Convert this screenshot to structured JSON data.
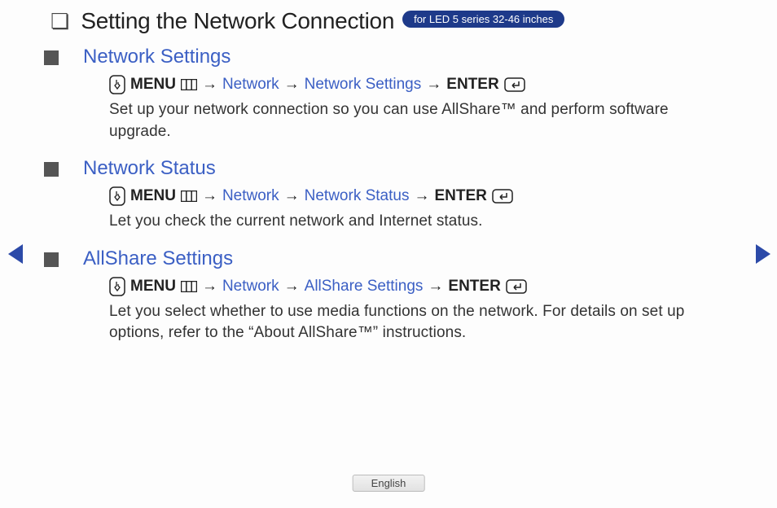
{
  "title": "Setting the Network Connection",
  "badge": "for LED 5 series 32-46 inches",
  "language": "English",
  "menu_label": "MENU",
  "enter_label": "ENTER",
  "arrow": "→",
  "sections": [
    {
      "heading": "Network Settings",
      "path_item1": "Network",
      "path_item2": "Network Settings",
      "description": "Set up your network connection so you can use AllShare™ and perform software upgrade."
    },
    {
      "heading": "Network Status",
      "path_item1": "Network",
      "path_item2": "Network Status",
      "description": "Let you check the current network and Internet status."
    },
    {
      "heading": "AllShare Settings",
      "path_item1": "Network",
      "path_item2": "AllShare Settings",
      "description": "Let you select whether to use media functions on the network. For details on set up options, refer to the “About AllShare™” instructions."
    }
  ]
}
